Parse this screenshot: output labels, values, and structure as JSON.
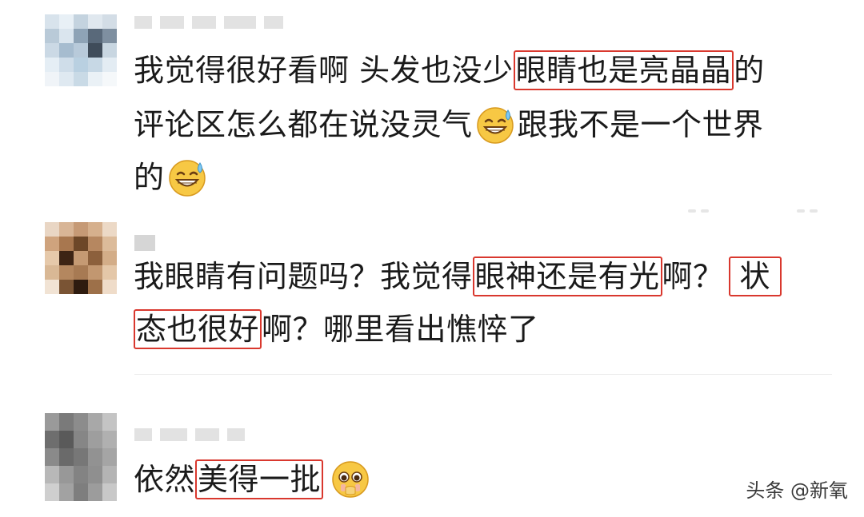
{
  "comments": [
    {
      "lines": [
        {
          "pre": "我觉得很好看啊 头发也没少",
          "hl": "眼睛也是亮晶晶",
          "post": "的"
        },
        {
          "pre": "评论区怎么都在说没灵气",
          "emoji": "grinning-sweat-emoji",
          "post": "跟我不是一个世界"
        },
        {
          "pre": "的",
          "emoji": "grinning-sweat-emoji"
        }
      ]
    },
    {
      "lines": [
        {
          "pre": "我眼睛有问题吗？我觉得",
          "hl": "眼神还是有光",
          "mid": "啊？",
          "hl2": "状"
        },
        {
          "hl": "态也很好",
          "post": "啊？哪里看出憔悴了"
        }
      ]
    },
    {
      "lines": [
        {
          "pre": "依然",
          "hl": "美得一批",
          "emoji": "pleading-face-emoji"
        }
      ]
    }
  ],
  "watermark": {
    "text": "头条 @新氧"
  },
  "colors": {
    "highlight_border": "#d9382e",
    "text": "#1a1a1a"
  }
}
